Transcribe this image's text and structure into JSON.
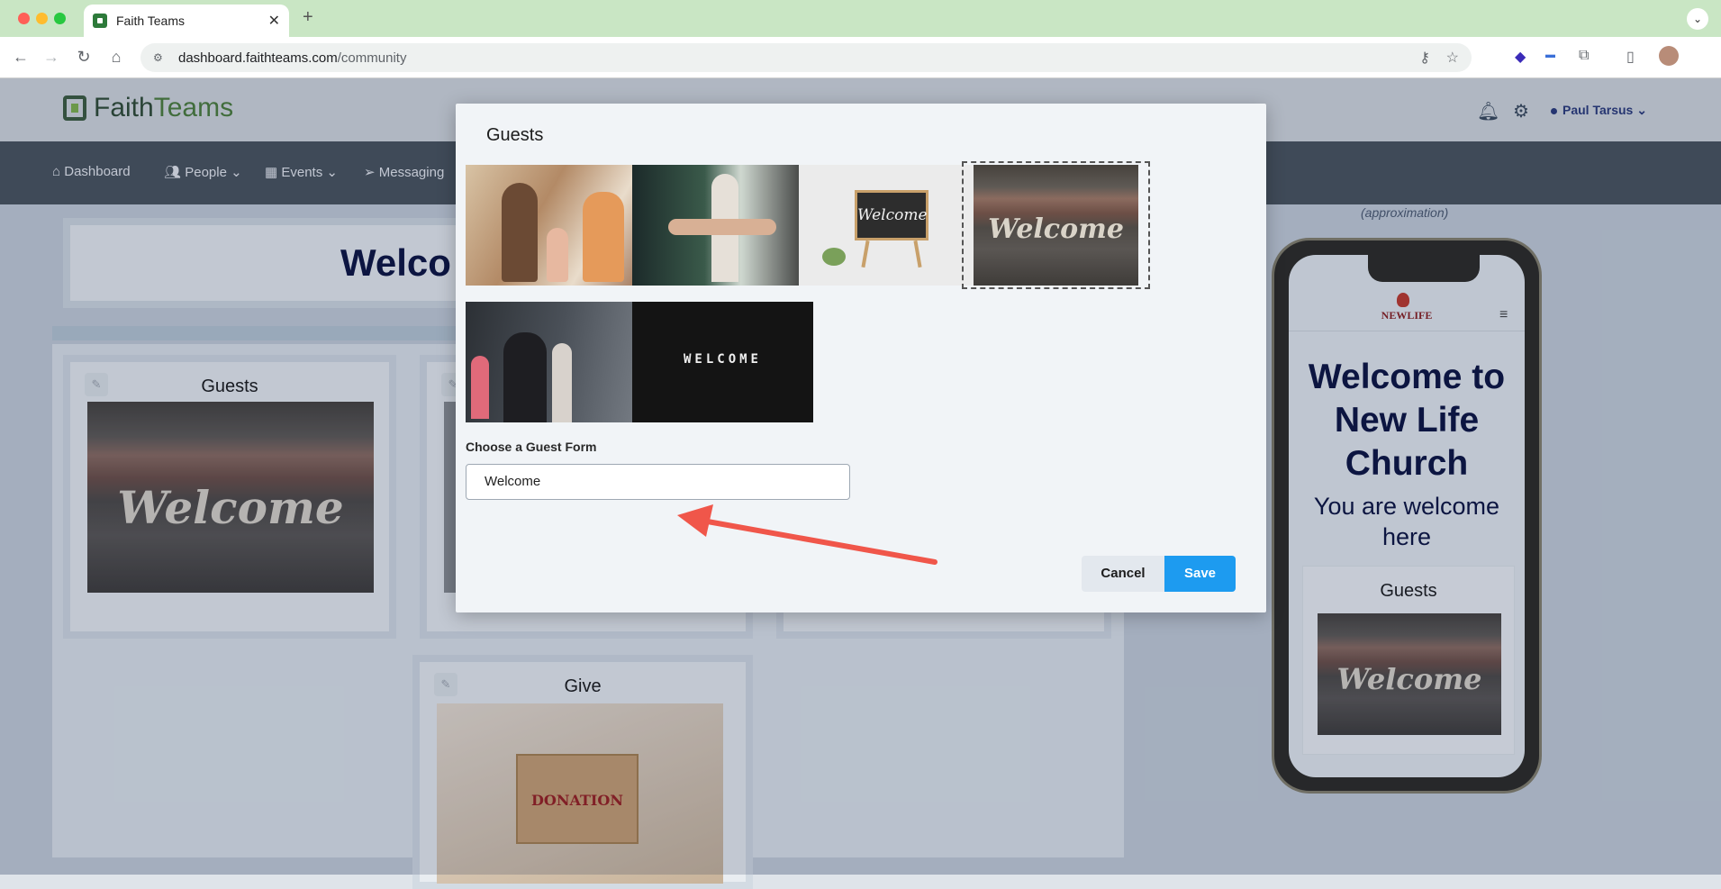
{
  "browser": {
    "tab_title": "Faith Teams",
    "url_host": "dashboard.faithteams.com",
    "url_path": "/community"
  },
  "app": {
    "logo_part1": "Faith",
    "logo_part2": "Teams",
    "user_name": "Paul Tarsus",
    "nav": {
      "dashboard": "Dashboard",
      "people": "People",
      "events": "Events",
      "messaging": "Messaging"
    }
  },
  "page": {
    "welcome_heading": "Welco",
    "cards": {
      "guests_title": "Guests",
      "give_title": "Give",
      "donation_text": "DONATION"
    }
  },
  "modal": {
    "title": "Guests",
    "images": [
      {
        "name": "family-at-door"
      },
      {
        "name": "handshake"
      },
      {
        "name": "welcome-chalkboard",
        "text": "Welcome"
      },
      {
        "name": "welcome-wood",
        "text": "Welcome",
        "selected": true
      },
      {
        "name": "greeting-at-entrance"
      },
      {
        "name": "welcome-letterboard",
        "text": "WELCOME"
      }
    ],
    "form_label": "Choose a Guest Form",
    "form_value": "Welcome",
    "cancel_label": "Cancel",
    "save_label": "Save"
  },
  "preview": {
    "approx_label": "(approximation)",
    "logo_text": "NEWLIFE",
    "heading": "Welcome to New Life Church",
    "subheading": "You are welcome here",
    "card_title": "Guests",
    "card_image_text": "Welcome"
  },
  "colors": {
    "accent": "#1d9bf0",
    "navy": "#0c1340",
    "nav_bg": "#4a535c"
  }
}
